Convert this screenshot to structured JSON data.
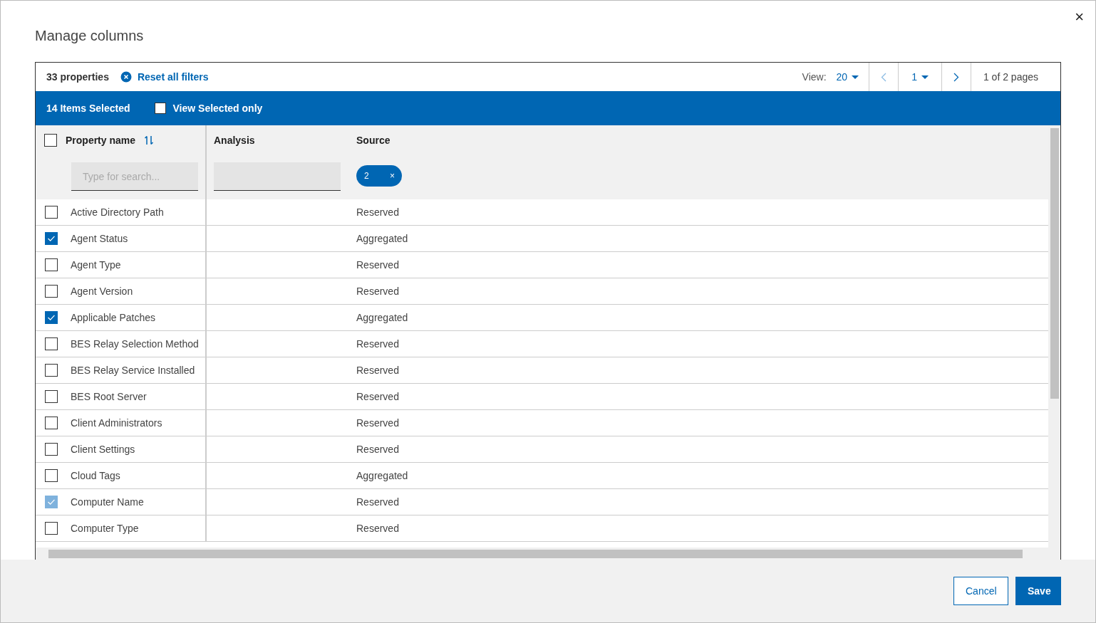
{
  "dialog": {
    "title": "Manage columns",
    "close": "×"
  },
  "toolbar": {
    "count": "33 properties",
    "reset": "Reset all filters",
    "view_label": "View:",
    "view_value": "20",
    "page_value": "1",
    "page_info": "1 of 2 pages"
  },
  "selection_bar": {
    "count": "14 Items Selected",
    "view_selected_label": "View Selected only",
    "view_selected_checked": false
  },
  "table": {
    "header_checked": false,
    "columns": [
      {
        "label": "Property name",
        "kind": "search",
        "placeholder": "Type for search..."
      },
      {
        "label": "Analysis",
        "kind": "empty"
      },
      {
        "label": "Source",
        "kind": "chip",
        "chip": "2",
        "chip_close": "×"
      }
    ],
    "rows": [
      {
        "name": "Active Directory Path",
        "source": "Reserved",
        "checked": false,
        "disabled": false
      },
      {
        "name": "Agent Status",
        "source": "Aggregated",
        "checked": true,
        "disabled": false
      },
      {
        "name": "Agent Type",
        "source": "Reserved",
        "checked": false,
        "disabled": false
      },
      {
        "name": "Agent Version",
        "source": "Reserved",
        "checked": false,
        "disabled": false
      },
      {
        "name": "Applicable Patches",
        "source": "Aggregated",
        "checked": true,
        "disabled": false
      },
      {
        "name": "BES Relay Selection Method",
        "source": "Reserved",
        "checked": false,
        "disabled": false
      },
      {
        "name": "BES Relay Service Installed",
        "source": "Reserved",
        "checked": false,
        "disabled": false
      },
      {
        "name": "BES Root Server",
        "source": "Reserved",
        "checked": false,
        "disabled": false
      },
      {
        "name": "Client Administrators",
        "source": "Reserved",
        "checked": false,
        "disabled": false
      },
      {
        "name": "Client Settings",
        "source": "Reserved",
        "checked": false,
        "disabled": false
      },
      {
        "name": "Cloud Tags",
        "source": "Aggregated",
        "checked": false,
        "disabled": false
      },
      {
        "name": "Computer Name",
        "source": "Reserved",
        "checked": true,
        "disabled": true
      },
      {
        "name": "Computer Type",
        "source": "Reserved",
        "checked": false,
        "disabled": false
      }
    ]
  },
  "buttons": [
    {
      "label": "Cancel",
      "kind": "secondary"
    },
    {
      "label": "Save",
      "kind": "primary"
    }
  ]
}
